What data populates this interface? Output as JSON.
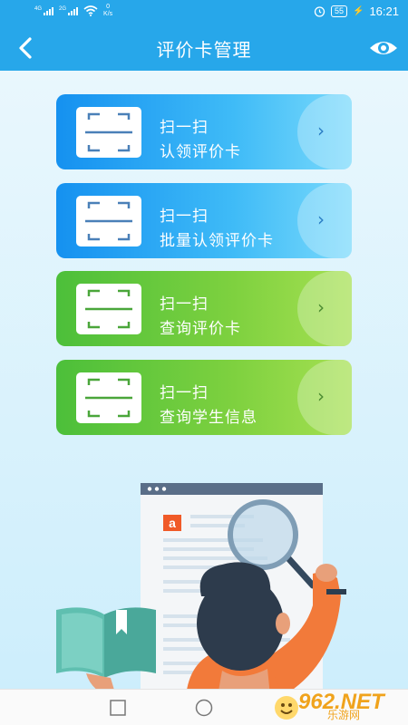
{
  "status_bar": {
    "signal1_label": "4G",
    "signal2_label": "2G",
    "speed_value": "0",
    "speed_unit": "K/s",
    "battery": "55",
    "time": "16:21"
  },
  "header": {
    "title": "评价卡管理",
    "back_icon": "chevron-left-icon",
    "eye_icon": "eye-icon"
  },
  "cards": [
    {
      "line1": "扫一扫",
      "line2": "认领评价卡",
      "color": "blue",
      "icon": "scan-icon",
      "arrow": "›"
    },
    {
      "line1": "扫一扫",
      "line2": "批量认领评价卡",
      "color": "blue",
      "icon": "scan-icon",
      "arrow": "›"
    },
    {
      "line1": "扫一扫",
      "line2": "查询评价卡",
      "color": "green",
      "icon": "scan-icon",
      "arrow": "›"
    },
    {
      "line1": "扫一扫",
      "line2": "查询学生信息",
      "color": "green",
      "icon": "scan-icon",
      "arrow": "›"
    }
  ],
  "colors": {
    "primary": "#27a7ea",
    "card_blue": "#1591f0",
    "card_green": "#4cbf3a",
    "scan_blue_icon": "#4a80b8",
    "scan_green_icon": "#4aa63a"
  },
  "watermark": {
    "big": "962.NET",
    "small": "乐游网"
  },
  "system_nav": {
    "recent_icon": "square-icon",
    "home_icon": "circle-icon"
  }
}
